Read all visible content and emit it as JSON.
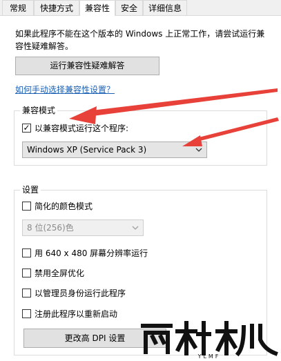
{
  "tabs": [
    "常规",
    "快捷方式",
    "兼容性",
    "安全",
    "详细信息"
  ],
  "intro_text_line1": "如果此程序不能在这个版本的 Windows 上正常工作，请尝试运行兼",
  "intro_text_line2": "容性疑难解答。",
  "troubleshooter_button": "运行兼容性疑难解答",
  "manual_link": "如何手动选择兼容性设置？",
  "compat_group": {
    "title": "兼容模式",
    "checkbox_label": "以兼容模式运行这个程序:",
    "checkbox_checked": true,
    "select_value": "Windows XP (Service Pack 3)"
  },
  "settings_group": {
    "title": "设置",
    "reduced_color_label": "简化的颜色模式",
    "color_select_value": "8 位(256)色",
    "res_label": "用 640 x 480 屏幕分辨率运行",
    "fullscreen_label": "禁用全屏优化",
    "admin_label": "以管理员身份运行此程序",
    "restart_label": "注册此程序以重新启动",
    "dpi_button": "更改高 DPI 设置"
  },
  "icons": {
    "checkmark": "check-icon",
    "dropdown": "chevron-down-icon",
    "annotation": "red-arrow"
  },
  "colors": {
    "arrow": "#e8413a",
    "link": "#1a5fb4"
  },
  "watermark": {
    "main": "雨林木风",
    "sub": "YLMF"
  }
}
